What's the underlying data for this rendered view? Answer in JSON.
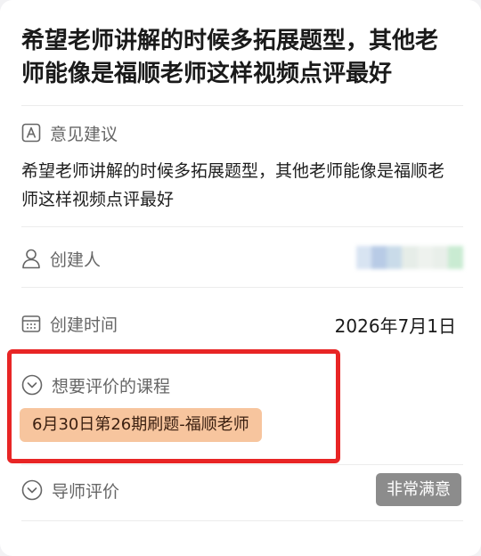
{
  "card": {
    "title": "希望老师讲解的时候多拓展题型，其他老师能像是福顺老师这样视频点评最好"
  },
  "fields": {
    "opinion": {
      "label": "意见建议",
      "icon": "letter-a-icon",
      "value": "希望老师讲解的时候多拓展题型，其他老师能像是福顺老师这样视频点评最好"
    },
    "creator": {
      "label": "创建人",
      "icon": "person-icon",
      "blur_colors": [
        "#d8e4f2",
        "#b8cbe6",
        "#c9dbe9",
        "#e6ede8",
        "#eef2ee",
        "#e9efea",
        "#c9ebd2"
      ]
    },
    "created_time": {
      "label": "创建时间",
      "icon": "calendar-icon",
      "value": "2026年7月1日"
    },
    "course": {
      "label": "想要评价的课程",
      "icon": "chevron-circle-icon",
      "value": "6月30日第26期刷题-福顺老师"
    },
    "tutor_rating": {
      "label": "导师评价",
      "icon": "chevron-circle-icon",
      "value": "非常满意"
    }
  },
  "colors": {
    "highlight_border": "#e82525",
    "course_chip_bg": "#f7c59e",
    "badge_bg": "#8c8c8c"
  }
}
